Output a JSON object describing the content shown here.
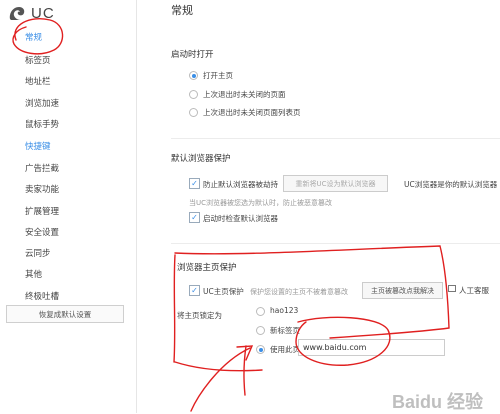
{
  "app": {
    "logo_text": "UC"
  },
  "sidebar": {
    "items": [
      {
        "label": "常规",
        "active": true
      },
      {
        "label": "标签页"
      },
      {
        "label": "地址栏"
      },
      {
        "label": "浏览加速"
      },
      {
        "label": "鼠标手势"
      },
      {
        "label": "快捷键",
        "active": true
      },
      {
        "label": "广告拦截"
      },
      {
        "label": "卖家功能"
      },
      {
        "label": "扩展管理"
      },
      {
        "label": "安全设置"
      },
      {
        "label": "云同步"
      },
      {
        "label": "其他"
      },
      {
        "label": "终极吐槽"
      }
    ],
    "reset_label": "恢复成默认设置"
  },
  "main": {
    "title": "常规",
    "startup": {
      "title": "启动时打开",
      "options": [
        "打开主页",
        "上次退出时未关闭的页面",
        "上次退出时未关闭页面列表页"
      ],
      "selected": 0
    },
    "default_browser": {
      "title": "默认浏览器保护",
      "prevent_label": "防止默认浏览器被劫持",
      "prevent_checked": true,
      "reset_button": "重新将UC设为默认浏览器",
      "status_text": "UC浏览器是你的默认浏览器",
      "hint": "当UC浏览器被您选为默认时，防止被恶意篡改",
      "check_on_start_label": "启动时检查默认浏览器",
      "check_on_start_checked": true
    },
    "homepage_protect": {
      "title": "浏览器主页保护",
      "protect_label": "UC主页保护",
      "protect_checked": true,
      "protect_hint": "保护您设置的主页不被着意篡改",
      "fix_button": "主页被篡改点我解决",
      "manual_label": "人工客服",
      "lock_label": "将主页锁定为",
      "options": [
        "hao123",
        "新标签页",
        "使用此页"
      ],
      "selected": 2,
      "url_value": "www.baidu.com"
    }
  },
  "watermark": "Baidu 经验",
  "colors": {
    "accent": "#3a8ee6",
    "annotation": "#e02020"
  }
}
